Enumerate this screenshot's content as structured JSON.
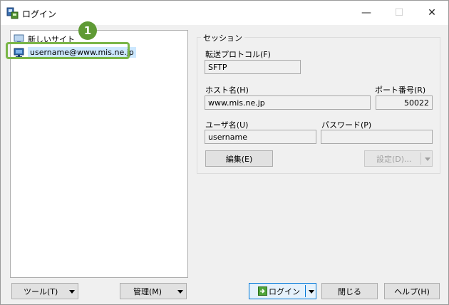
{
  "window": {
    "title": "ログイン",
    "minimize": "—",
    "maximize": "☐",
    "close": "✕"
  },
  "site_tree": {
    "items": [
      {
        "label": "新しいサイト",
        "icon": "new-site-icon"
      },
      {
        "label": "username@www.mis.ne.jp",
        "icon": "monitor-icon",
        "selected": true
      }
    ]
  },
  "annotation": {
    "badge": "1",
    "highlight_color": "#7ab648",
    "badge_color": "#5f9a35"
  },
  "session": {
    "group_title": "セッション",
    "protocol_label": "転送プロトコル(F)",
    "protocol_value": "SFTP",
    "host_label": "ホスト名(H)",
    "host_value": "www.mis.ne.jp",
    "port_label": "ポート番号(R)",
    "port_value": "50022",
    "user_label": "ユーザ名(U)",
    "user_value": "username",
    "password_label": "パスワード(P)",
    "password_value": "",
    "edit_button": "編集(E)",
    "settings_button": "設定(D)..."
  },
  "footer": {
    "tools_button": "ツール(T)",
    "manage_button": "管理(M)",
    "login_button": "ログイン",
    "close_button": "閉じる",
    "help_button": "ヘルプ(H)"
  }
}
